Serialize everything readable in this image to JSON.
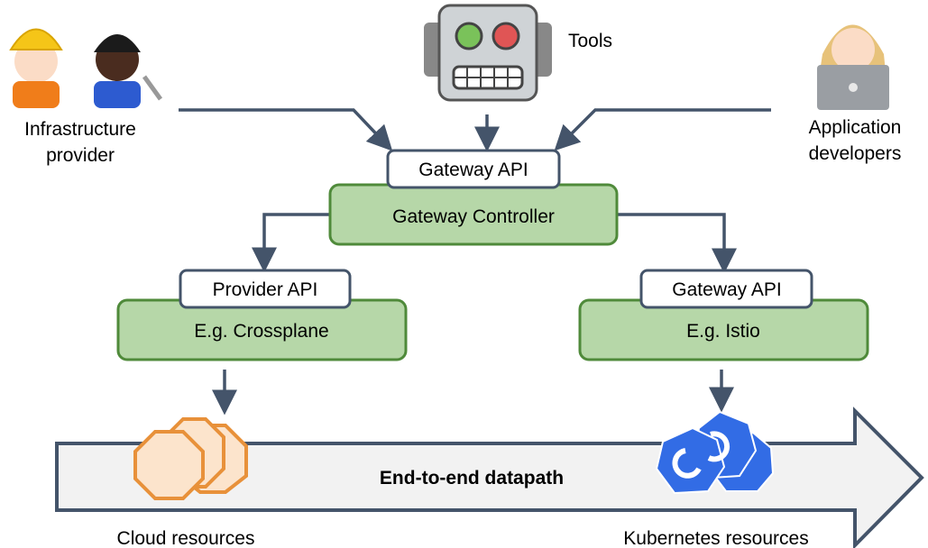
{
  "actors": {
    "infra": {
      "line1": "Infrastructure",
      "line2": "provider",
      "icon": "construction-workers-icon"
    },
    "tools": {
      "label": "Tools",
      "icon": "robot-icon"
    },
    "devs": {
      "line1": "Application",
      "line2": "developers",
      "icon": "developer-laptop-icon"
    }
  },
  "boxes": {
    "gateway_api_top": "Gateway API",
    "gateway_controller": "Gateway Controller",
    "provider_api": "Provider API",
    "crossplane": "E.g. Crossplane",
    "gateway_api_right": "Gateway API",
    "istio": "E.g. Istio"
  },
  "datapath": {
    "label": "End-to-end datapath"
  },
  "resources": {
    "cloud": "Cloud resources",
    "kubernetes": "Kubernetes resources"
  },
  "colors": {
    "arrow": "#44546a",
    "green_fill": "#b6d7a8",
    "green_stroke": "#4f8a3a",
    "cloud_fill": "#fce4cc",
    "cloud_stroke": "#e8913a",
    "k8s": "#326ce5",
    "datapath_fill": "#f2f2f2"
  }
}
